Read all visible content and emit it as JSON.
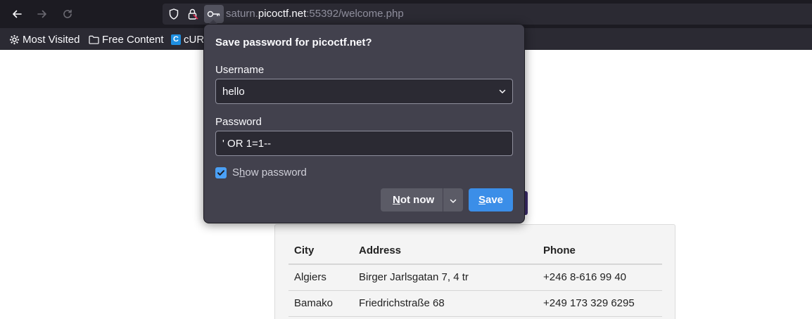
{
  "browser": {
    "url_host_prefix": "saturn.",
    "url_host": "picoctf.net",
    "url_rest": ":55392/welcome.php",
    "icons": [
      "back-arrow-icon",
      "forward-arrow-icon",
      "reload-icon",
      "shield-icon",
      "lock-icon",
      "key-icon"
    ]
  },
  "bookmarks": [
    {
      "label": "Most Visited",
      "icon": "gear-icon"
    },
    {
      "label": "Free Content",
      "icon": "folder-icon"
    },
    {
      "label": "cUR",
      "icon": "c-badge-icon",
      "badge": "C"
    }
  ],
  "popup": {
    "title": "Save password for picoctf.net?",
    "username_label": "Username",
    "username_value": "hello",
    "password_label": "Password",
    "password_value": "' OR 1=1--",
    "show_password_pre": "S",
    "show_password_ul": "h",
    "show_password_post": "ow password",
    "show_password_checked": true,
    "not_now_ul": "N",
    "not_now_rest": "ot now",
    "save_ul": "S",
    "save_rest": "ave"
  },
  "table": {
    "headers": [
      "City",
      "Address",
      "Phone"
    ],
    "rows": [
      [
        "Algiers",
        "Birger Jarlsgatan 7, 4 tr",
        "+246 8-616 99 40"
      ],
      [
        "Bamako",
        "Friedrichstraße 68",
        "+249 173 329 6295"
      ]
    ]
  },
  "colors": {
    "toolbar_bg": "#1c1b22",
    "urlbar_bg": "#2b2a33",
    "popup_bg": "#42414d",
    "accent_blue": "#3b8ee8"
  }
}
